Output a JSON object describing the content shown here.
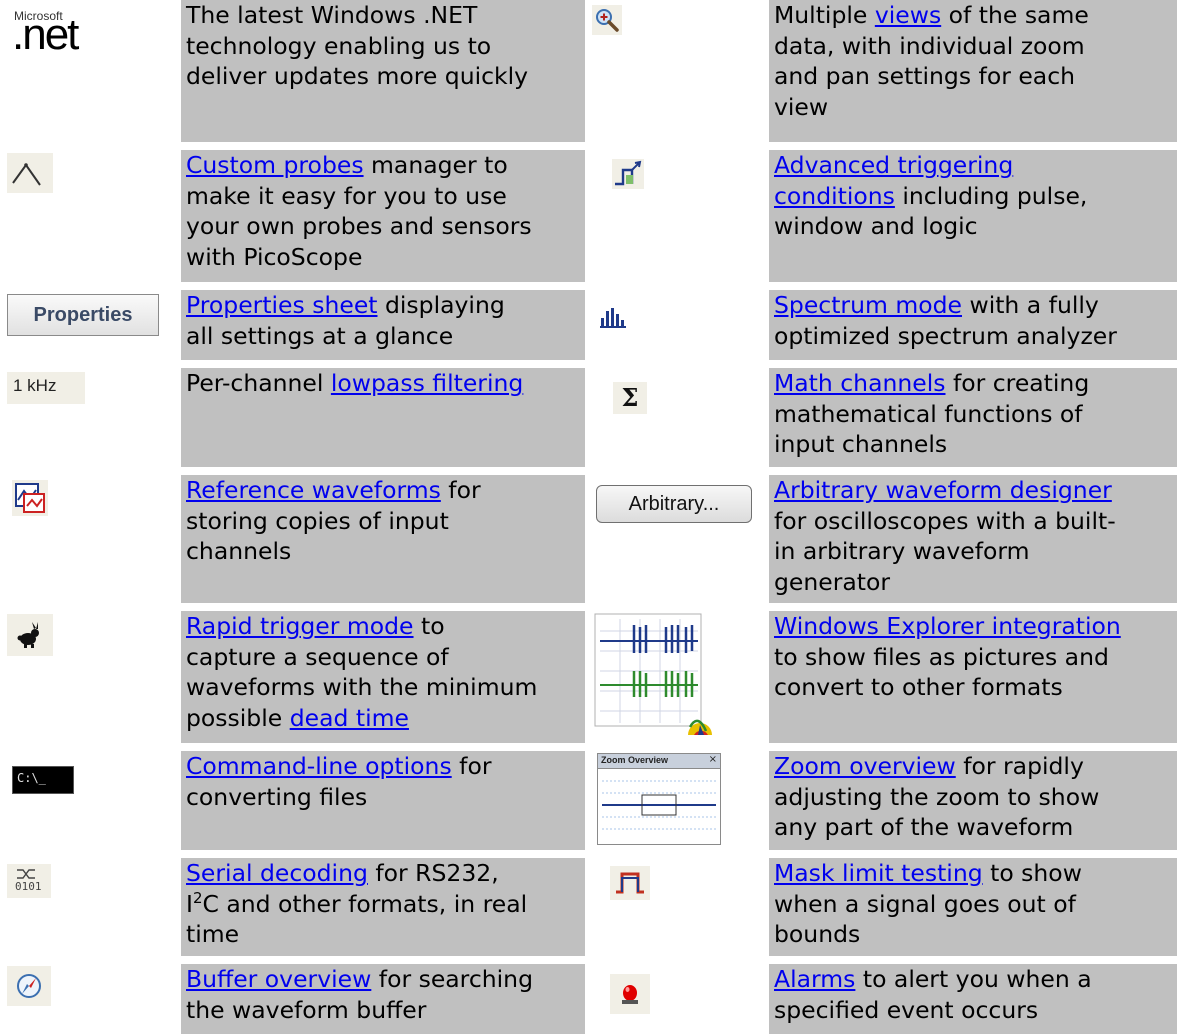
{
  "rows": [
    {
      "left": {
        "icon": "microsoft-net-logo",
        "logo_small": "Microsoft",
        "logo_big": ".net",
        "lines": [
          [
            {
              "t": "The latest Windows .NET"
            }
          ],
          [
            {
              "t": "technology enabling us to"
            }
          ],
          [
            {
              "t": "deliver updates more quickly"
            }
          ]
        ]
      },
      "right": {
        "icon": "zoom-in-icon",
        "lines": [
          [
            {
              "t": "Multiple "
            },
            {
              "t": "views",
              "link": true
            },
            {
              "t": " of the same"
            }
          ],
          [
            {
              "t": "data, with individual zoom"
            }
          ],
          [
            {
              "t": "and pan settings for each"
            }
          ],
          [
            {
              "t": "view"
            }
          ]
        ]
      }
    },
    {
      "left": {
        "icon": "probe-icon",
        "lines": [
          [
            {
              "t": "Custom probes",
              "link": true
            },
            {
              "t": " manager to"
            }
          ],
          [
            {
              "t": "make it easy for you to use"
            }
          ],
          [
            {
              "t": "your own probes and sensors"
            }
          ],
          [
            {
              "t": "with PicoScope"
            }
          ]
        ]
      },
      "right": {
        "icon": "advanced-trigger-icon",
        "lines": [
          [
            {
              "t": "Advanced triggering",
              "link": true
            }
          ],
          [
            {
              "t": "conditions",
              "link": true
            },
            {
              "t": " including pulse,"
            }
          ],
          [
            {
              "t": "window and logic"
            }
          ]
        ]
      }
    },
    {
      "left": {
        "icon": "properties-button-icon",
        "icon_label": "Properties",
        "lines": [
          [
            {
              "t": "Properties sheet",
              "link": true
            },
            {
              "t": " displaying"
            }
          ],
          [
            {
              "t": "all settings at a glance"
            }
          ]
        ]
      },
      "right": {
        "icon": "spectrum-icon",
        "lines": [
          [
            {
              "t": "Spectrum mode",
              "link": true
            },
            {
              "t": " with a fully"
            }
          ],
          [
            {
              "t": "optimized spectrum analyzer"
            }
          ]
        ]
      }
    },
    {
      "left": {
        "icon": "lowpass-filter-icon",
        "icon_label": "1 kHz",
        "lines": [
          [
            {
              "t": "Per-channel "
            },
            {
              "t": "lowpass filtering",
              "link": true
            }
          ]
        ]
      },
      "right": {
        "icon": "sigma-icon",
        "icon_label": "Σ",
        "lines": [
          [
            {
              "t": "Math channels",
              "link": true
            },
            {
              "t": " for creating"
            }
          ],
          [
            {
              "t": "mathematical functions of"
            }
          ],
          [
            {
              "t": "input channels"
            }
          ]
        ]
      }
    },
    {
      "left": {
        "icon": "reference-waveform-icon",
        "lines": [
          [
            {
              "t": "Reference waveforms",
              "link": true
            },
            {
              "t": " for"
            }
          ],
          [
            {
              "t": "storing copies of input"
            }
          ],
          [
            {
              "t": "channels"
            }
          ]
        ]
      },
      "right": {
        "icon": "arbitrary-button-icon",
        "icon_label": "Arbitrary...",
        "lines": [
          [
            {
              "t": "Arbitrary waveform designer",
              "link": true
            }
          ],
          [
            {
              "t": "for oscilloscopes with a built-"
            }
          ],
          [
            {
              "t": "in arbitrary waveform"
            }
          ],
          [
            {
              "t": "generator"
            }
          ]
        ]
      }
    },
    {
      "left": {
        "icon": "rabbit-icon",
        "lines": [
          [
            {
              "t": "Rapid trigger mode",
              "link": true
            },
            {
              "t": " to"
            }
          ],
          [
            {
              "t": "capture a sequence of"
            }
          ],
          [
            {
              "t": "waveforms with the minimum"
            }
          ],
          [
            {
              "t": "possible "
            },
            {
              "t": "dead time",
              "link": true
            }
          ]
        ]
      },
      "right": {
        "icon": "explorer-thumbnail-icon",
        "lines": [
          [
            {
              "t": "Windows Explorer integration",
              "link": true
            }
          ],
          [
            {
              "t": "to show files as pictures and"
            }
          ],
          [
            {
              "t": "convert to other formats"
            }
          ]
        ]
      }
    },
    {
      "left": {
        "icon": "command-line-icon",
        "icon_label": "C:\\_",
        "lines": [
          [
            {
              "t": "Command-line options",
              "link": true
            },
            {
              "t": " for"
            }
          ],
          [
            {
              "t": "converting files"
            }
          ]
        ]
      },
      "right": {
        "icon": "zoom-overview-icon",
        "icon_label": "Zoom Overview",
        "lines": [
          [
            {
              "t": "Zoom overview",
              "link": true
            },
            {
              "t": " for rapidly"
            }
          ],
          [
            {
              "t": "adjusting the zoom to show"
            }
          ],
          [
            {
              "t": "any part of the waveform"
            }
          ]
        ]
      }
    },
    {
      "left": {
        "icon": "serial-decoding-icon",
        "icon_label": "0101",
        "lines": [
          [
            {
              "t": "Serial decoding",
              "link": true
            },
            {
              "t": " for RS232,"
            }
          ],
          [
            {
              "t": "I"
            },
            {
              "t": "2",
              "sup": true
            },
            {
              "t": "C and other formats, in real"
            }
          ],
          [
            {
              "t": "time"
            }
          ]
        ]
      },
      "right": {
        "icon": "mask-limit-icon",
        "lines": [
          [
            {
              "t": "Mask limit testing",
              "link": true
            },
            {
              "t": " to show"
            }
          ],
          [
            {
              "t": "when a signal goes out of"
            }
          ],
          [
            {
              "t": "bounds"
            }
          ]
        ]
      }
    },
    {
      "left": {
        "icon": "compass-icon",
        "lines": [
          [
            {
              "t": "Buffer overview",
              "link": true
            },
            {
              "t": " for searching"
            }
          ],
          [
            {
              "t": "the waveform buffer"
            }
          ]
        ]
      },
      "right": {
        "icon": "alarm-light-icon",
        "lines": [
          [
            {
              "t": "Alarms",
              "link": true
            },
            {
              "t": " to alert you when a"
            }
          ],
          [
            {
              "t": "specified event occurs"
            }
          ]
        ]
      }
    }
  ]
}
